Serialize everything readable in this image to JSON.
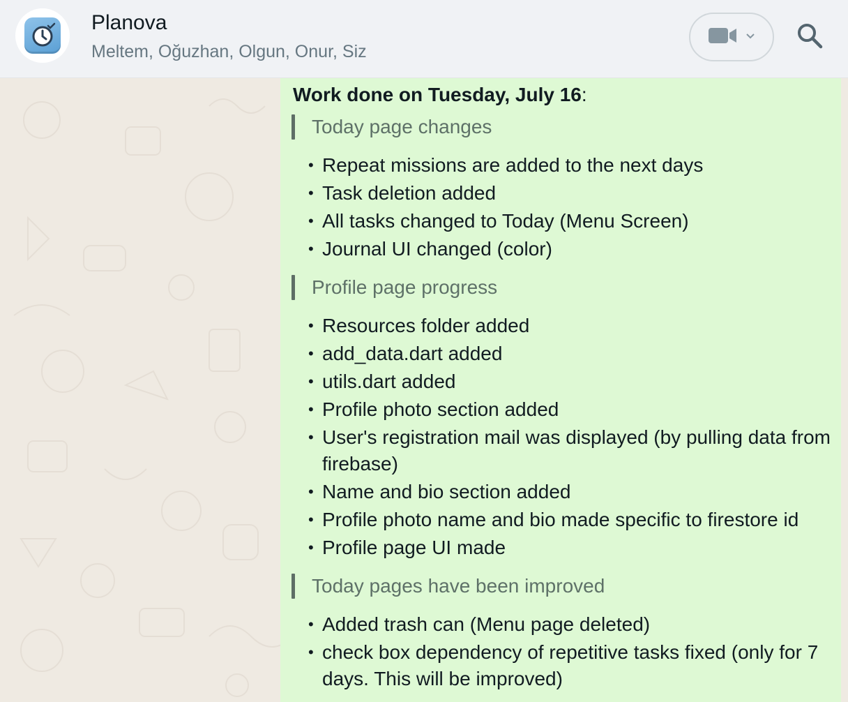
{
  "header": {
    "title": "Planova",
    "participants": "Meltem, Oğuzhan, Olgun, Onur, Siz",
    "avatar_icon": "planner-clock-icon",
    "video_icon": "video-camera-icon",
    "search_icon": "search-icon"
  },
  "message": {
    "heading_bold": "Work done on Tuesday, July 16",
    "heading_suffix": ":",
    "sections": [
      {
        "title": "Today page changes",
        "items": [
          "Repeat missions are added to the next days",
          "Task deletion added",
          "All tasks changed to Today (Menu Screen)",
          "Journal UI changed (color)"
        ]
      },
      {
        "title": "Profile page progress",
        "items": [
          "Resources folder added",
          "add_data.dart added",
          "utils.dart added",
          "Profile photo section added",
          "User's registration mail was displayed (by pulling data from firebase)",
          "Name and bio section added",
          "Profile photo name and bio made specific to firestore id",
          "Profile page UI made"
        ]
      },
      {
        "title": "Today pages have been improved",
        "items": [
          "Added trash can (Menu page deleted)",
          "check box dependency of repetitive tasks fixed (only for 7 days. This will be improved)"
        ]
      }
    ]
  },
  "colors": {
    "header_bg": "#f0f2f5",
    "bubble_bg": "#def9d4",
    "wallpaper_bg": "#efeae2",
    "quote_bar": "#5e6e66"
  }
}
